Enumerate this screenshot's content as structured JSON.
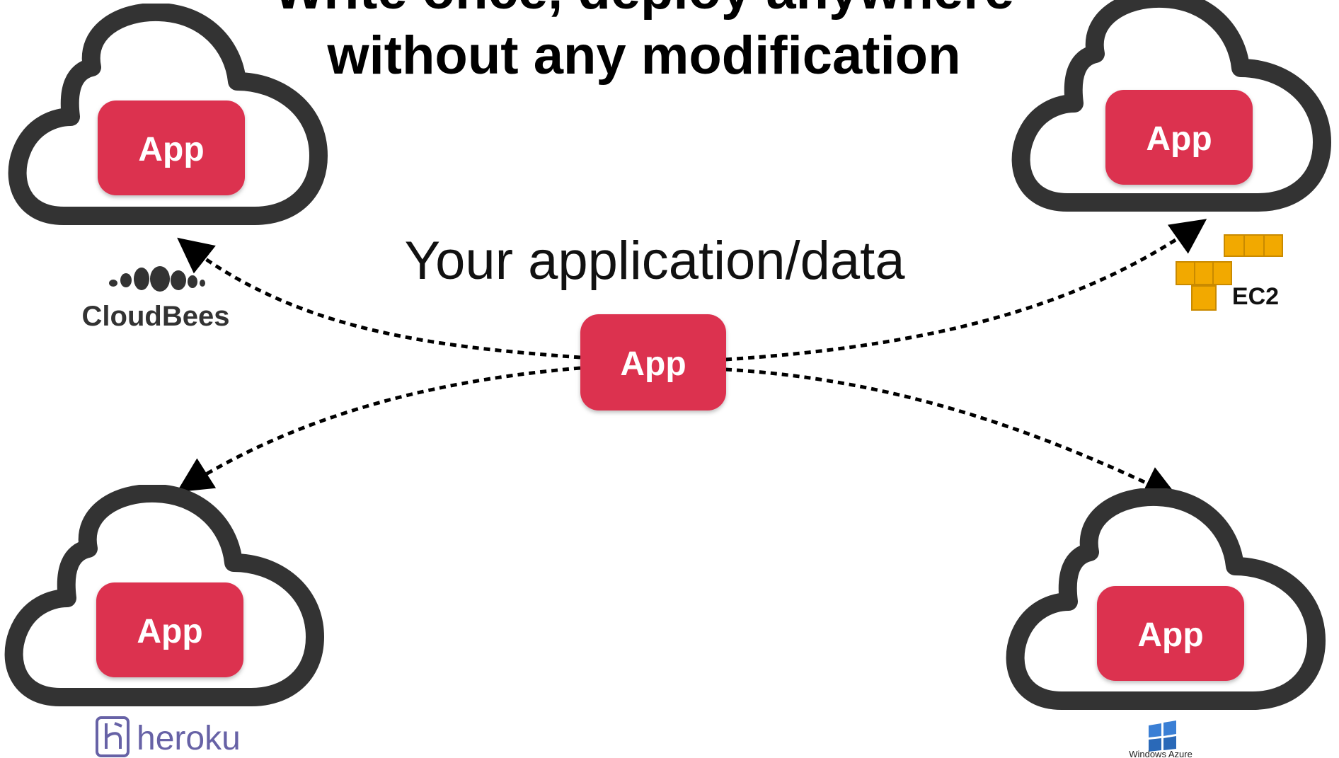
{
  "title": {
    "line1": "Write once, deploy anywhere",
    "line2": "without any modification"
  },
  "subtitle": "Your application/data",
  "center": {
    "label": "App"
  },
  "clouds": [
    {
      "id": "cloudbees",
      "label": "App",
      "provider": "CloudBees"
    },
    {
      "id": "ec2",
      "label": "App",
      "provider": "EC2"
    },
    {
      "id": "heroku",
      "label": "App",
      "provider": "heroku"
    },
    {
      "id": "azure",
      "label": "App",
      "provider": "Windows Azure"
    }
  ],
  "colors": {
    "app_box": "#dc3050",
    "cloud_outline": "#333333",
    "arrow": "#000000",
    "aws_orange": "#f2a900",
    "heroku_purple": "#6762a6",
    "cloudbees_gray": "#333333"
  }
}
